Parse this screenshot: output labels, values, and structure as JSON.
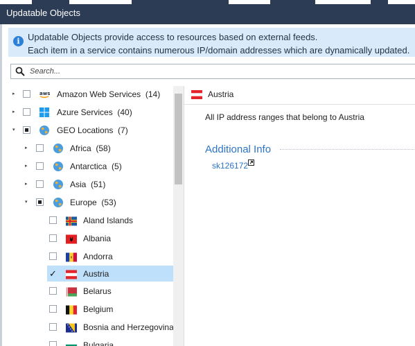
{
  "window": {
    "title": "Updatable Objects"
  },
  "info": {
    "line1": "Updatable Objects provide access to resources based on external feeds.",
    "line2": "Each item in a service contains numerous IP/domain addresses which are dynamically updated."
  },
  "search": {
    "placeholder": "Search..."
  },
  "tree": {
    "aws": {
      "label": "Amazon Web Services",
      "count": "(14)",
      "icon": "aws-logo"
    },
    "azure": {
      "label": "Azure Services",
      "count": "(40)",
      "icon": "windows-logo"
    },
    "geo": {
      "label": "GEO Locations",
      "count": "(7)",
      "icon": "globe-icon"
    },
    "africa": {
      "label": "Africa",
      "count": "(58)"
    },
    "antarctica": {
      "label": "Antarctica",
      "count": "(5)"
    },
    "asia": {
      "label": "Asia",
      "count": "(51)"
    },
    "europe": {
      "label": "Europe",
      "count": "(53)"
    },
    "countries": [
      {
        "label": "Aland Islands",
        "flag": "aland-flag"
      },
      {
        "label": "Albania",
        "flag": "albania-flag"
      },
      {
        "label": "Andorra",
        "flag": "andorra-flag"
      },
      {
        "label": "Austria",
        "flag": "austria-flag",
        "selected": true
      },
      {
        "label": "Belarus",
        "flag": "belarus-flag"
      },
      {
        "label": "Belgium",
        "flag": "belgium-flag"
      },
      {
        "label": "Bosnia and Herzegovina",
        "flag": "bosnia-flag"
      },
      {
        "label": "Bulgaria",
        "flag": "bulgaria-flag"
      }
    ]
  },
  "detail": {
    "title": "Austria",
    "description": "All IP address ranges that belong to Austria",
    "section": "Additional Info",
    "link": "sk126172"
  },
  "colors": {
    "titlebar": "#2d3c55",
    "info_bg": "#d9ebfb",
    "link": "#2c74c7",
    "selection": "#bfe0fa"
  }
}
